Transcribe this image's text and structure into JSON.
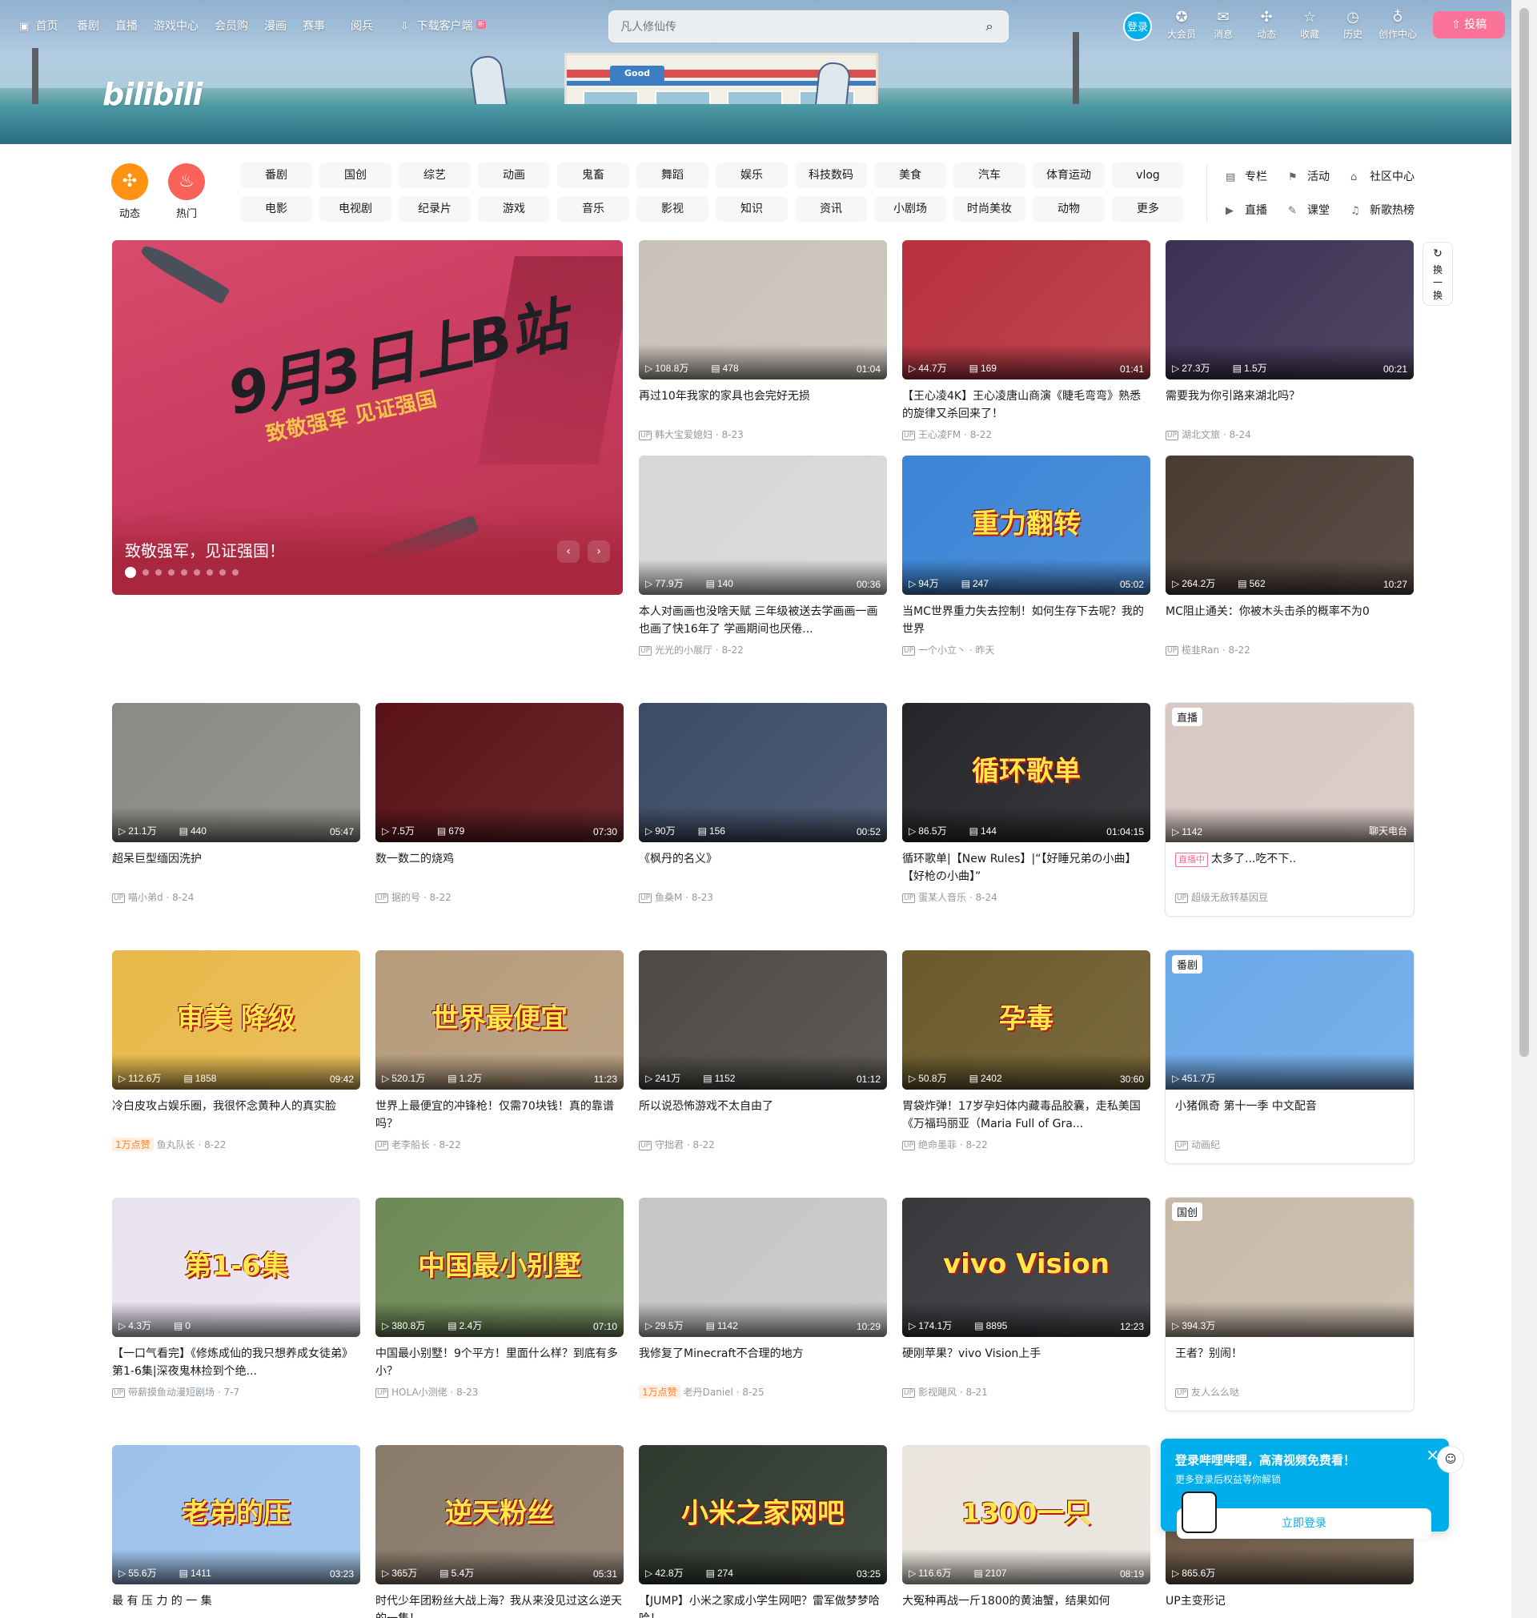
{
  "topnav": {
    "left": [
      "首页",
      "番剧",
      "直播",
      "游戏中心",
      "会员购",
      "漫画",
      "赛事",
      "阅兵",
      "下载客户端"
    ],
    "download_badge": "新",
    "search_placeholder": "凡人修仙传",
    "login": "登录",
    "right": [
      "大会员",
      "消息",
      "动态",
      "收藏",
      "历史",
      "创作中心"
    ],
    "upload": "投稿"
  },
  "logo": "bilibili",
  "channels": {
    "feeds": [
      {
        "label": "动态",
        "color": "#ff9212",
        "icon": "pinwheel-icon"
      },
      {
        "label": "热门",
        "color": "#f9625b",
        "icon": "flame-icon"
      }
    ],
    "row1": [
      "番剧",
      "国创",
      "综艺",
      "动画",
      "鬼畜",
      "舞蹈",
      "娱乐",
      "科技数码",
      "美食",
      "汽车",
      "体育运动",
      "vlog"
    ],
    "row2": [
      "电影",
      "电视剧",
      "纪录片",
      "游戏",
      "音乐",
      "影视",
      "知识",
      "资讯",
      "小剧场",
      "时尚美妆",
      "动物",
      "更多"
    ],
    "right1": [
      "专栏",
      "活动",
      "社区中心"
    ],
    "right2": [
      "直播",
      "课堂",
      "新歌热榜"
    ]
  },
  "hero": {
    "big_text": "9月3日上B站",
    "sub_text": "致敬强军 见证强国",
    "caption": "致敬强军，见证强国！",
    "dots": 9
  },
  "swap": [
    "换",
    "一",
    "换"
  ],
  "cards": [
    {
      "views": "108.8万",
      "danmaku": "478",
      "dur": "01:04",
      "title": "再过10年我家的家具也会完好无损",
      "author": "韩大宝爱媳妇",
      "date": "8-23",
      "bg": "#c9c2b8"
    },
    {
      "views": "44.7万",
      "danmaku": "169",
      "dur": "01:41",
      "title": "【王心凌4K】王心凌唐山商演《睫毛弯弯》熟悉的旋律又杀回来了！",
      "author": "王心凌FM",
      "date": "8-22",
      "bg": "#b8313e"
    },
    {
      "views": "27.3万",
      "danmaku": "1.5万",
      "dur": "00:21",
      "title": "需要我为你引路来湖北吗？",
      "author": "湖北文旅",
      "date": "8-24",
      "bg": "#3d3254"
    },
    {
      "views": "77.9万",
      "danmaku": "140",
      "dur": "00:36",
      "title": "本人对画画也没啥天赋 三年级被送去学画画一画也画了快16年了 学画期间也厌倦...",
      "author": "光光的小展厅",
      "date": "8-22",
      "bg": "#d7d7d7"
    },
    {
      "views": "94万",
      "danmaku": "247",
      "dur": "05:02",
      "title": "当MC世界重力失去控制！如何生存下去呢？我的世界",
      "author": "一个小立丶",
      "date": "昨天",
      "bg": "#3b84d6",
      "over": "重力翻转"
    },
    {
      "views": "264.2万",
      "danmaku": "562",
      "dur": "10:27",
      "title": "MC阻止通关：你被木头击杀的概率不为0",
      "author": "榄韭Ran",
      "date": "8-22",
      "bg": "#4b3b33"
    },
    {
      "views": "21.1万",
      "danmaku": "440",
      "dur": "05:47",
      "title": "超呆巨型缅因洗护",
      "author": "喵小弟d",
      "date": "8-24",
      "bg": "#8c8a86"
    },
    {
      "views": "7.5万",
      "danmaku": "679",
      "dur": "07:30",
      "title": "数一数二的烧鸡",
      "author": "据的号",
      "date": "8-22",
      "bg": "#5a1216"
    },
    {
      "views": "90万",
      "danmaku": "156",
      "dur": "00:52",
      "title": "《枫丹的名义》",
      "author": "鱼桑M",
      "date": "8-23",
      "bg": "#3c4c66"
    },
    {
      "views": "86.5万",
      "danmaku": "144",
      "dur": "01:04:15",
      "title": "循环歌单|【New Rules】|“【好睡兄弟の小曲】【好枪の小曲】”",
      "author": "蛋某人音乐",
      "date": "8-24",
      "bg": "#26262a",
      "over": "循环歌单"
    },
    {
      "live": true,
      "badge": "直播",
      "views": "1142",
      "dur": "聊天电台",
      "status": "直播中",
      "title": "太多了...吃不下..",
      "author": "超级无敌转基因豆",
      "bg": "#d9c8c4"
    },
    {
      "views": "112.6万",
      "danmaku": "1858",
      "dur": "09:42",
      "title": "冷白皮攻占娱乐圈，我很怀念黄种人的真实脸",
      "hot": "1万点赞",
      "author": "鱼丸队长",
      "date": "8-22",
      "bg": "#e8b94a",
      "over": "审美 降级"
    },
    {
      "views": "520.1万",
      "danmaku": "1.2万",
      "dur": "11:23",
      "title": "世界上最便宜的冲锋枪！仅需70块钱！真的靠谱吗？",
      "author": "老李船长",
      "date": "8-22",
      "bg": "#b59b7a",
      "over": "世界最便宜"
    },
    {
      "views": "241万",
      "danmaku": "1152",
      "dur": "01:12",
      "title": "所以说恐怖游戏不太自由了",
      "author": "守拙君",
      "date": "8-22",
      "bg": "#4d4a45"
    },
    {
      "views": "50.8万",
      "danmaku": "2402",
      "dur": "30:60",
      "title": "胃袋炸弹！17岁孕妇体内藏毒品胶囊，走私美国《万福玛丽亚（Maria Full of Gra...",
      "author": "绝命墨菲",
      "date": "8-22",
      "bg": "#6b5a2a",
      "over": "孕毒"
    },
    {
      "live": true,
      "badge": "番剧",
      "views": "451.7万",
      "title": "小猪佩奇 第十一季 中文配音",
      "author": "动画纪",
      "bg": "#6aa8e8"
    },
    {
      "views": "4.3万",
      "danmaku": "0",
      "dur": "",
      "title": "【一口气看完】《修炼成仙的我只想养成女徒弟》第1-6集|深夜鬼林捡到个绝...",
      "author": "带薪摸鱼动漫短剧场",
      "date": "7-7",
      "bg": "#e9e3ef",
      "over": "第1-6集"
    },
    {
      "views": "380.8万",
      "danmaku": "2.4万",
      "dur": "07:10",
      "title": "中国最小别墅！9个平方！里面什么样？到底有多小？",
      "author": "HOLA小测佬",
      "date": "8-23",
      "bg": "#6d8a55",
      "over": "中国最小别墅"
    },
    {
      "views": "29.5万",
      "danmaku": "1142",
      "dur": "10:29",
      "title": "我修复了Minecraft不合理的地方",
      "hot": "1万点赞",
      "author": "老丹Daniel",
      "date": "8-25",
      "bg": "#c6c6c6"
    },
    {
      "views": "174.1万",
      "danmaku": "8895",
      "dur": "12:23",
      "title": "硬刚苹果？vivo Vision上手",
      "author": "影视飓风",
      "date": "8-21",
      "bg": "#37393d",
      "over": "vivo Vision"
    },
    {
      "live": true,
      "badge": "国创",
      "views": "394.3万",
      "title": "王者？别闹！",
      "author": "友人么么哒",
      "bg": "#c9b9a8"
    },
    {
      "views": "55.6万",
      "danmaku": "1411",
      "dur": "03:23",
      "title": "最 有 压 力 的 一 集",
      "author": "",
      "date": "",
      "bg": "#9cc2ec",
      "over": "老弟的压"
    },
    {
      "views": "365万",
      "danmaku": "5.4万",
      "dur": "05:31",
      "title": "时代少年团粉丝大战上海？我从来没见过这么逆天的一集！",
      "author": "",
      "date": "",
      "bg": "#8a7a6a",
      "over": "逆天粉丝"
    },
    {
      "views": "42.8万",
      "danmaku": "274",
      "dur": "03:25",
      "title": "【JUMP】小米之家成小学生网吧？雷军做梦梦哈哈！",
      "author": "",
      "date": "",
      "bg": "#2f3a2f",
      "over": "小米之家网吧"
    },
    {
      "views": "116.6万",
      "danmaku": "2107",
      "dur": "08:19",
      "title": "大冤种再战一斤1800的黄油蟹，结果如何",
      "author": "",
      "date": "",
      "bg": "#e9e4dc",
      "over": "1300一只"
    },
    {
      "views": "865.6万",
      "danmaku": "",
      "dur": "",
      "title": "UP主变形记",
      "author": "",
      "date": "",
      "bg": "#6b5845"
    }
  ],
  "loginpop": {
    "title": "登录哔哩哔哩，高清视频免费看！",
    "desc": "更多登录后权益等你解锁",
    "button": "立即登录"
  }
}
